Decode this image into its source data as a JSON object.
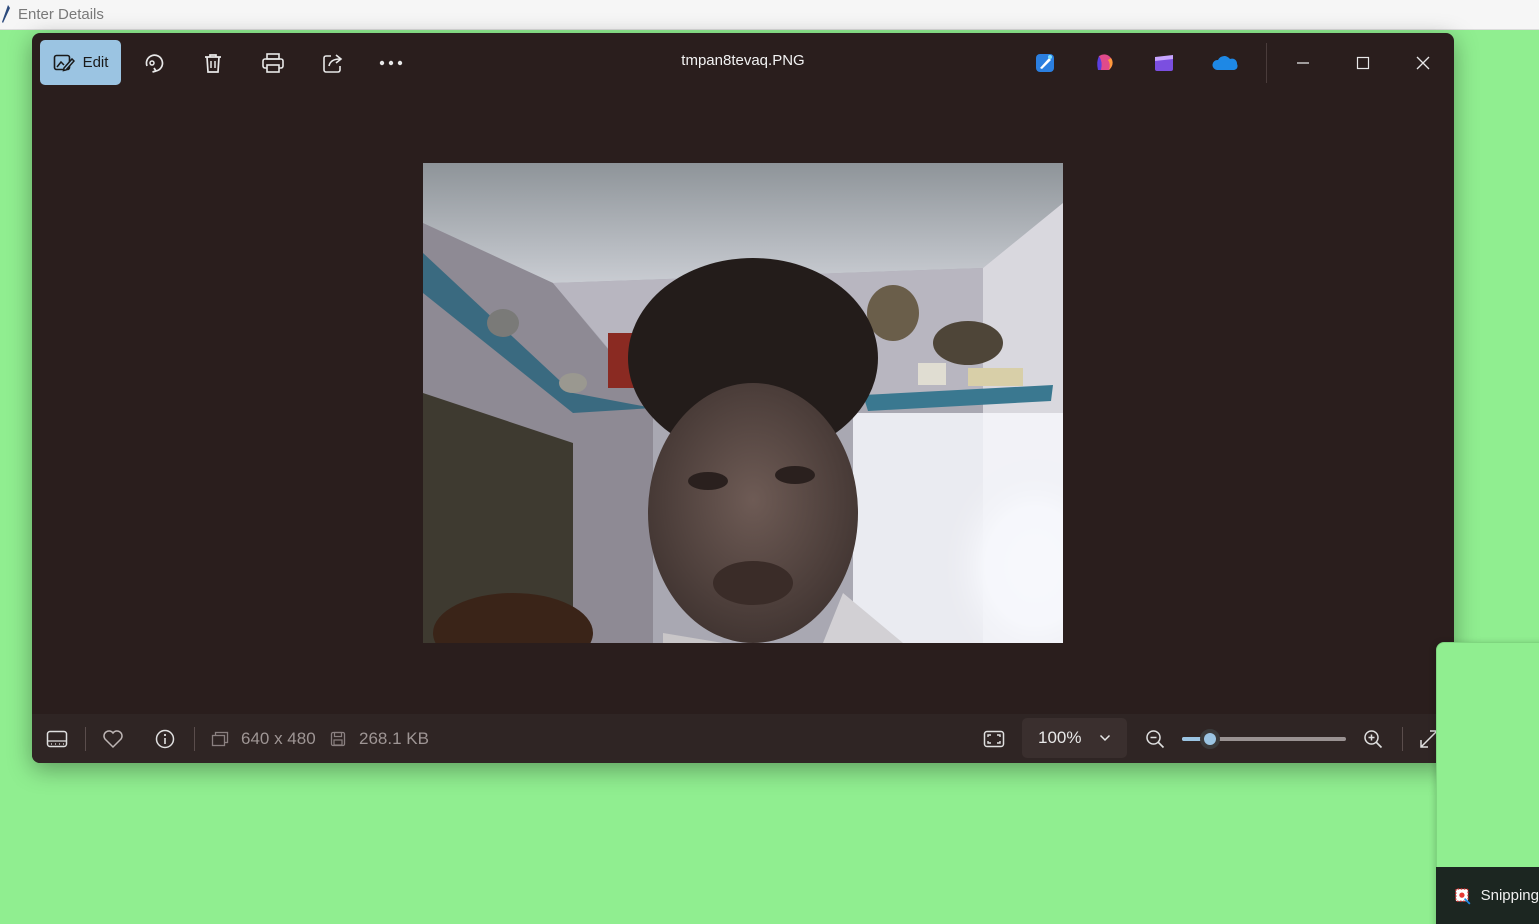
{
  "background_window": {
    "title": "Enter Details"
  },
  "photos_window": {
    "file_name": "tmpan8tevaq.PNG",
    "toolbar": {
      "edit_label": "Edit"
    },
    "image": {
      "dimensions_text": "640 x 480",
      "file_size_text": "268.1 KB"
    },
    "zoom": {
      "value_text": "100%",
      "slider_level": 0.17
    }
  },
  "snipping_tool": {
    "label": "Snipping"
  },
  "colors": {
    "desktop": "#90ee90",
    "window_bg": "#2a1e1d",
    "accent": "#9bc4e2"
  }
}
